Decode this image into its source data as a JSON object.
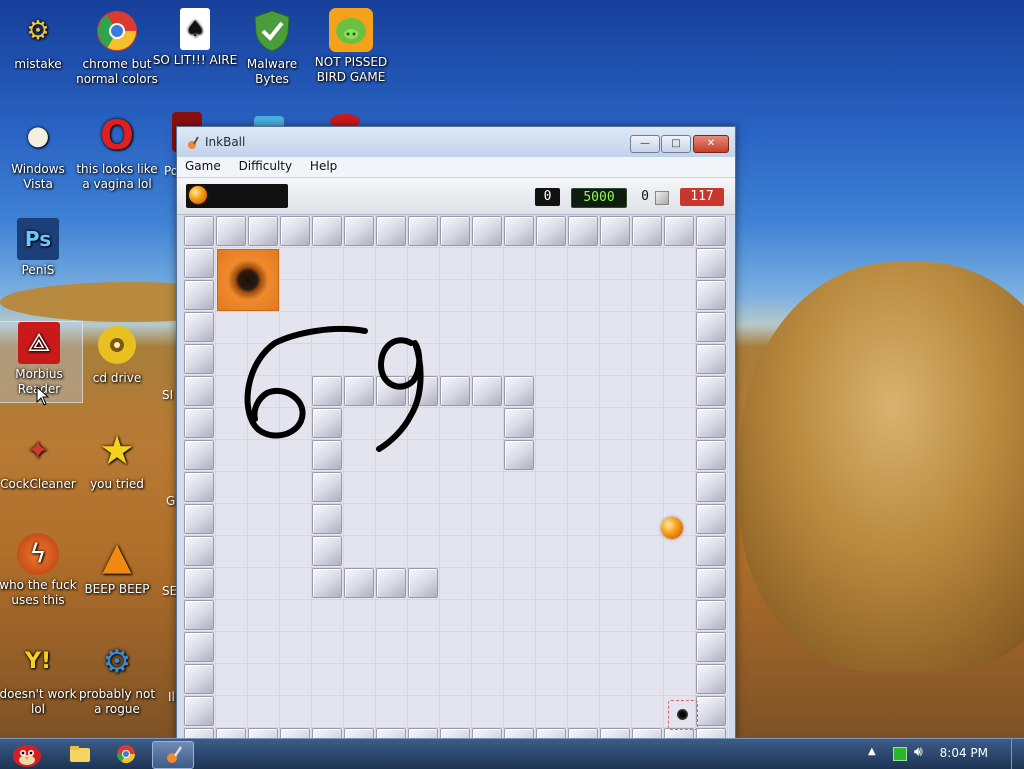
{
  "desktop": {
    "icons": [
      {
        "label": "mistake",
        "glyph": "⚙",
        "color": "#f2c53a"
      },
      {
        "label": "chrome but normal colors",
        "glyph": "◉",
        "color": "#e33"
      },
      {
        "label": "SO LIT!!! AIRE",
        "glyph": "♠",
        "color": "#fff"
      },
      {
        "label": "Malware Bytes",
        "glyph": "✔",
        "color": "#4a9d3a"
      },
      {
        "label": "NOT PISSED BIRD GAME",
        "glyph": "☻",
        "color": "#6bc040"
      },
      {
        "label": "Windows Vista",
        "glyph": "●",
        "color": "#f4f0e0"
      },
      {
        "label": "this looks like a vagina lol",
        "glyph": "O",
        "color": "#e02020"
      },
      {
        "label": "PeniS",
        "glyph": "Ps",
        "color": "#1c3f7a"
      },
      {
        "label": "Morbius Reader",
        "glyph": "⟁",
        "color": "#c81a1a"
      },
      {
        "label": "cd drive",
        "glyph": "◎",
        "color": "#e8c020"
      },
      {
        "label": "CockCleaner",
        "glyph": "✦",
        "color": "#d33a2a"
      },
      {
        "label": "you tried",
        "glyph": "★",
        "color": "#f5d21c"
      },
      {
        "label": "who the fuck uses this",
        "glyph": "ϟ",
        "color": "#e86a20"
      },
      {
        "label": "BEEP BEEP",
        "glyph": "▲",
        "color": "#f08a10"
      },
      {
        "label": "doesn't work lol",
        "glyph": "Y!",
        "color": "#7a2fa0"
      },
      {
        "label": "probably not a rogue",
        "glyph": "⚙",
        "color": "#3a8ad0"
      }
    ],
    "partial_labels": [
      "Po",
      "SI",
      "G",
      "SE",
      "Il"
    ]
  },
  "window": {
    "title": "InkBall",
    "menu": [
      "Game",
      "Difficulty",
      "Help"
    ],
    "counters": {
      "left": "0",
      "score": "5000",
      "captured": "0",
      "time": "117"
    },
    "colors": {
      "accent": "#f08a2c",
      "score_fg": "#8cff5a",
      "time_bg": "#c8372c"
    },
    "ink_drawing": "69"
  },
  "taskbar": {
    "clock": "8:04 PM"
  }
}
